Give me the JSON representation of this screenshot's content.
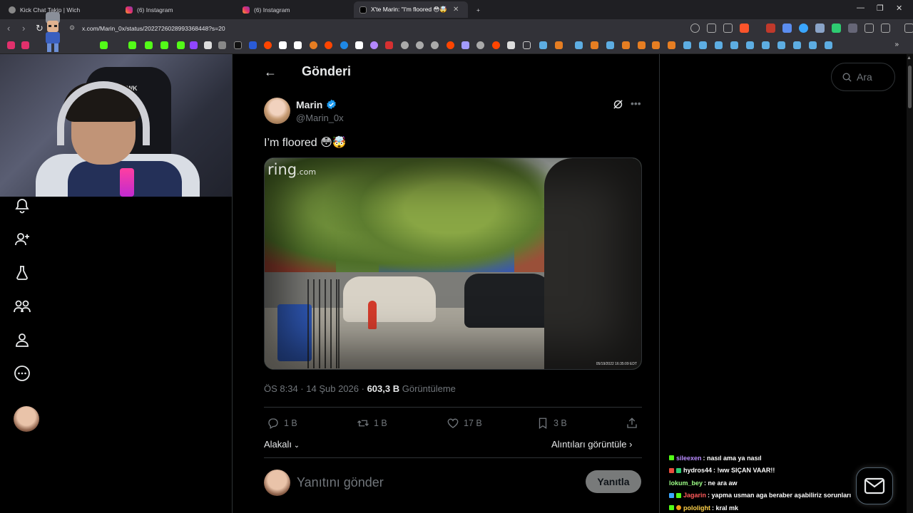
{
  "browser": {
    "tabs": [
      {
        "title": "Kick Chat Takip | Wich",
        "active": false
      },
      {
        "title": "(6) Instagram",
        "active": false
      },
      {
        "title": "(6) Instagram",
        "active": false
      },
      {
        "title": "X'te Marin: \"I'm floored 😳🤯",
        "active": true
      }
    ],
    "new_tab_label": "+",
    "url": "x.com/Marin_0x/status/2022726028993368448?s=20"
  },
  "webcam": {
    "chair_logo": "HAWK"
  },
  "sidebar": {
    "items": [
      {
        "icon": "bell-icon"
      },
      {
        "icon": "add-person-icon"
      },
      {
        "icon": "flask-icon"
      },
      {
        "icon": "communities-icon"
      },
      {
        "icon": "profile-icon"
      },
      {
        "icon": "more-circle-icon"
      }
    ]
  },
  "header": {
    "back": "←",
    "title": "Gönderi"
  },
  "post": {
    "author_name": "Marin",
    "author_handle": "@Marin_0x",
    "text": "I’m floored 😳🤯",
    "video": {
      "logo": "ring",
      "logo_suffix": ".com",
      "timestamp": "05/19/2022 16:35:09 EDT"
    },
    "time": "ÖS 8:34 · 14 Şub 2026 ·",
    "views_count": "603,3 B",
    "views_label": "Görüntüleme",
    "actions": {
      "replies": "1 B",
      "reposts": "1 B",
      "likes": "17 B",
      "bookmarks": "3 B"
    },
    "sort_label": "Alakalı",
    "quotes_label": "Alıntıları görüntüle"
  },
  "reply": {
    "placeholder": "Yanıtını gönder",
    "button_label": "Yanıtla"
  },
  "search": {
    "placeholder": "Ara"
  },
  "chat": [
    {
      "user": "sileexen",
      "message": ": nasıl ama ya nasıl",
      "color": "#b98cff"
    },
    {
      "user": "hydros44",
      "message": ": !ww SIÇAN VAAR!!",
      "color": "#ffffff"
    },
    {
      "user": "lokum_bey",
      "message": ": ne ara aw",
      "color": "#9dff86"
    },
    {
      "user": "Jagarin",
      "message": ": yapma usman aga beraber aşabiliriz sorunları",
      "color": "#ff5a5a"
    },
    {
      "user": "pololight",
      "message": ": kral mk",
      "color": "#ffd24a"
    }
  ],
  "colors": {
    "accent": "#1d9bf0",
    "text": "#e7e9ea",
    "muted": "#71767b",
    "border": "#2f3336"
  }
}
